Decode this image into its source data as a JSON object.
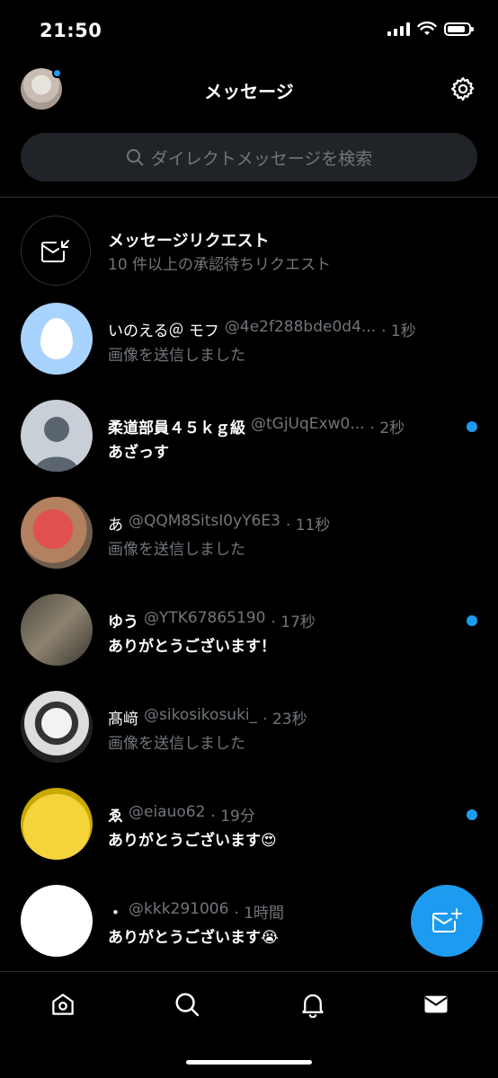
{
  "status_bar": {
    "time": "21:50",
    "battery_level": 0.85
  },
  "header": {
    "title": "メッセージ",
    "avatar_icon": "profile-avatar",
    "settings_icon": "gear-icon",
    "notification_dot_color": "#1d9bf0"
  },
  "search": {
    "placeholder": "ダイレクトメッセージを検索",
    "icon": "search-icon"
  },
  "requests": {
    "title": "メッセージリクエスト",
    "subtitle": "10 件以上の承認待ちリクエスト",
    "icon": "mail-arrow-icon"
  },
  "conversations": [
    {
      "name": "いのえる＠ モフ",
      "handle": "@4e2f288bde0d4...",
      "time": "· 1秒",
      "preview": "画像を送信しました",
      "unread": false
    },
    {
      "name": "柔道部員４５ｋｇ級",
      "handle": "@tGjUqExw0...",
      "time": "· 2秒",
      "preview": "あざっす",
      "unread": true
    },
    {
      "name": "あ",
      "handle": "@QQM8SitsI0yY6E3",
      "time": "· 11秒",
      "preview": "画像を送信しました",
      "unread": false
    },
    {
      "name": "ゆう",
      "handle": "@YTK67865190",
      "time": "· 17秒",
      "preview": "ありがとうございます！",
      "unread": true
    },
    {
      "name": "髙﨑",
      "handle": "@sikosikosuki_",
      "time": "· 23秒",
      "preview": "画像を送信しました",
      "unread": false
    },
    {
      "name": "ゑ",
      "handle": "@eiauo62",
      "time": "· 19分",
      "preview": "ありがとうございます😍",
      "unread": true
    },
    {
      "name": "・",
      "handle": "@kkk291006",
      "time": "· 1時間",
      "preview": "ありがとうございます😭",
      "unread": true
    }
  ],
  "fab": {
    "icon": "new-message-icon",
    "color": "#1d9bf0"
  },
  "bottom_nav": [
    {
      "icon": "home-icon"
    },
    {
      "icon": "search-icon"
    },
    {
      "icon": "bell-icon"
    },
    {
      "icon": "mail-icon",
      "active": true
    }
  ],
  "colors": {
    "accent": "#1d9bf0",
    "secondary_text": "#71767b",
    "divider": "#2f3336",
    "search_bg": "#202327"
  }
}
